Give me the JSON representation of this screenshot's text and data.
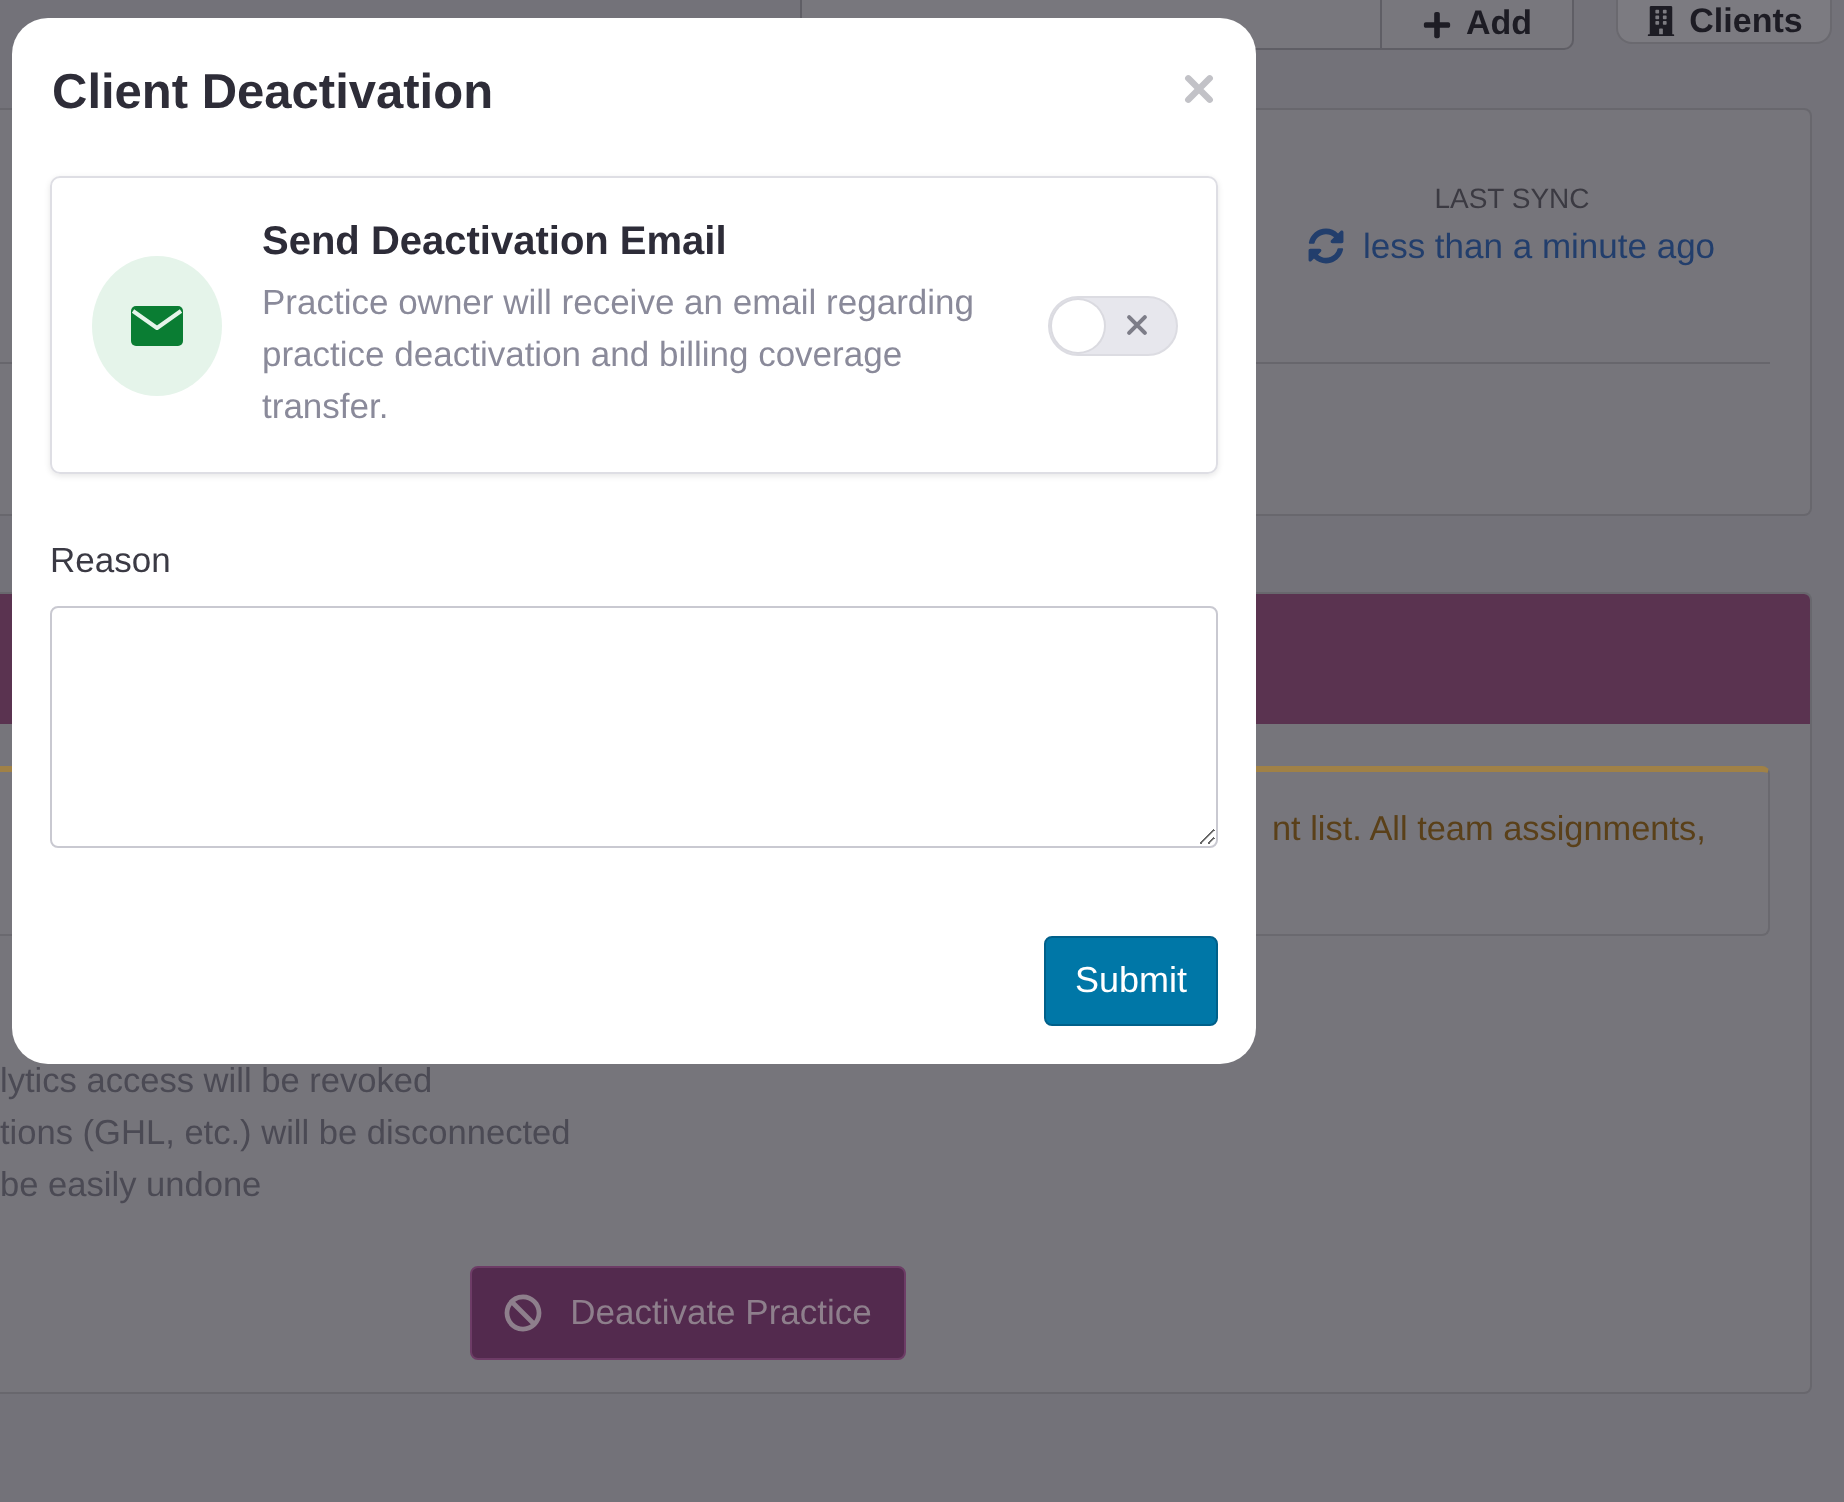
{
  "page": {
    "toolbar": {
      "buttons": [
        {
          "kind": "add",
          "label": "Add"
        },
        {
          "kind": "clients",
          "label": "Clients"
        }
      ]
    },
    "sync_card": {
      "label": "LAST SYNC",
      "value": "less than a minute ago"
    },
    "warning": {
      "text": "nt list. All team assignments,"
    },
    "consequences": [
      "lytics access will be revoked",
      "tions (GHL, etc.) will be disconnected",
      "be easily undone"
    ],
    "deactivate_button": {
      "label": "Deactivate Practice"
    }
  },
  "modal": {
    "title": "Client Deactivation",
    "email_option": {
      "title": "Send Deactivation Email",
      "description": "Practice owner will receive an email regarding practice deactivation and billing coverage transfer.",
      "on": false
    },
    "reason": {
      "label": "Reason"
    },
    "buttons": [
      "Submit"
    ]
  }
}
